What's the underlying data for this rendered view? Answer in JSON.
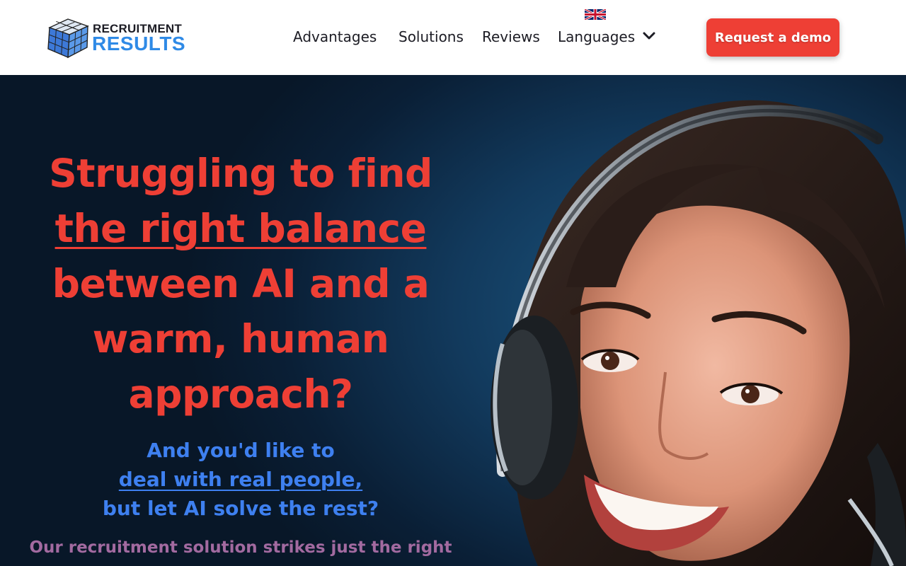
{
  "header": {
    "logo": {
      "line1": "RECRUITMENT",
      "line2": "RESULTS",
      "icon": "rubiks-cube-icon"
    },
    "language_flag": "uk-flag-icon",
    "nav": [
      {
        "label": "Advantages"
      },
      {
        "label": "Solutions"
      },
      {
        "label": "Reviews"
      },
      {
        "label": "Languages",
        "icon": "chevron-down-icon"
      }
    ],
    "cta_label": "Request a demo"
  },
  "hero": {
    "headline": {
      "line1": "Struggling to find",
      "line2": "the right balance",
      "line3": "between AI and a",
      "line4": "warm, human",
      "line5": "approach?"
    },
    "subheadline": {
      "line1": "And you'd like to",
      "line2": "deal with real people,",
      "line3": "but let AI solve the rest?"
    },
    "tagline": "Our recruitment solution strikes just the right"
  },
  "colors": {
    "brand_red": "#ee3f35",
    "brand_blue": "#2f8ae6",
    "sub_blue": "#3e80f0",
    "tagline_purple": "#a26aa0",
    "hero_bg": "#0a1f36"
  }
}
